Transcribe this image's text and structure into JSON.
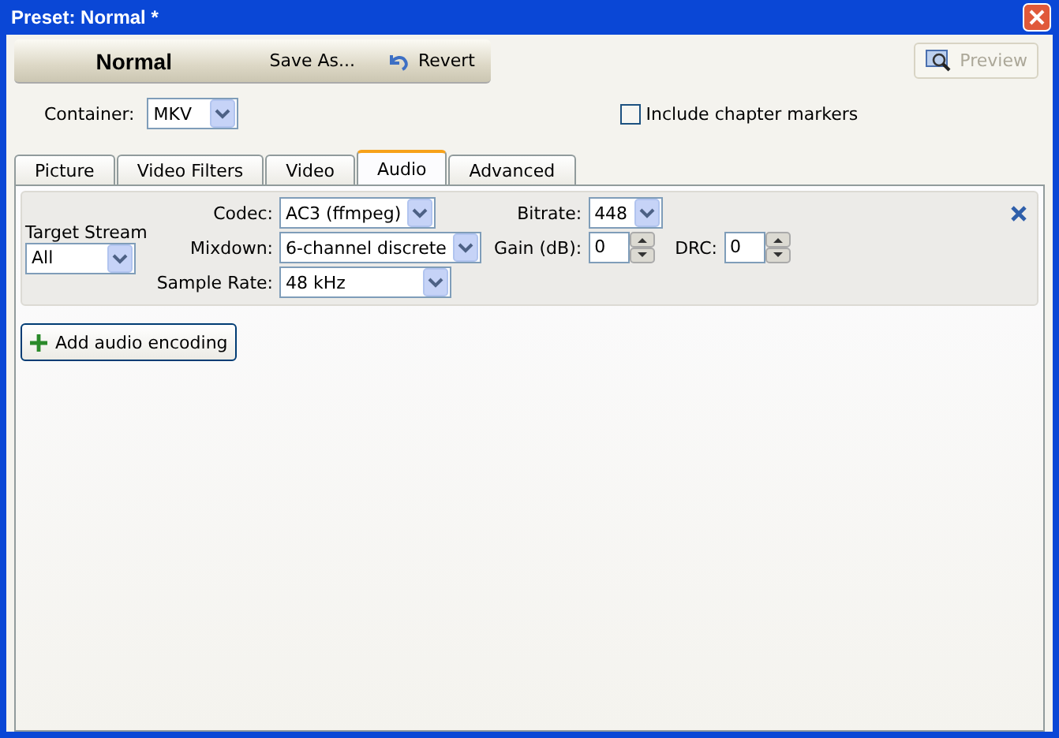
{
  "window": {
    "title": "Preset: Normal *"
  },
  "toolbar": {
    "preset_name": "Normal",
    "buttons": [
      {
        "label": "Save As...",
        "kind": "text"
      },
      {
        "label": "Revert",
        "kind": "revert"
      }
    ]
  },
  "preview_button": {
    "label": "Preview",
    "disabled": true
  },
  "container": {
    "label": "Container:",
    "value": "MKV"
  },
  "chapter_markers": {
    "label": "Include chapter markers",
    "checked": false
  },
  "tabs": [
    {
      "label": "Picture",
      "selected": false
    },
    {
      "label": "Video Filters",
      "selected": false
    },
    {
      "label": "Video",
      "selected": false
    },
    {
      "label": "Audio",
      "selected": true
    },
    {
      "label": "Advanced",
      "selected": false
    }
  ],
  "audio_tracks": [
    {
      "target_stream": {
        "label": "Target Stream",
        "value": "All"
      },
      "codec": {
        "label": "Codec:",
        "value": "AC3 (ffmpeg)"
      },
      "bitrate": {
        "label": "Bitrate:",
        "value": "448"
      },
      "mixdown": {
        "label": "Mixdown:",
        "value": "6-channel discrete"
      },
      "gain": {
        "label": "Gain (dB):",
        "value": "0"
      },
      "drc": {
        "label": "DRC:",
        "value": "0"
      },
      "sample_rate": {
        "label": "Sample Rate:",
        "value": "48 kHz"
      }
    }
  ],
  "add_button": {
    "label": "Add audio encoding"
  }
}
